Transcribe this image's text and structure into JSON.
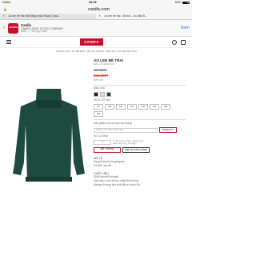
{
  "status": {
    "carrier": "Viettel",
    "time": "09:25",
    "battery": "50%"
  },
  "browser": {
    "url": "canifa.com",
    "tabs": [
      "Áo len bé trai mặt đăng nhập thoại (Cloud...",
      "Áo len bé trai - Bé trai - Ưu đãi 00..."
    ]
  },
  "banner": {
    "app_name": "Canifa",
    "company": "CANIFA JOINT STOCK COMPANY",
    "store": "Miễn — Trên App Store",
    "view": "Xem",
    "logo_text": "CANIFA"
  },
  "header": {
    "logo": "CANIFA"
  },
  "breadcrumb": "TRANG CHỦ / ÁO BÉ ĐÓN - BLACK FRIDAY / BÉ TRAI / ÁO LEN BÉ TRAI",
  "product": {
    "title": "ÁO LEN BÉ TRAI",
    "sku": "MÃ: 2TE18A001N",
    "old_price": "329.000₫",
    "new_price": "164.500₫",
    "discount": "50% Off",
    "color_label": "MÀU SẮC",
    "colors": [
      "#1e1f22",
      "#d8d8d8",
      "#1e4a40"
    ],
    "size_label": "KÍCH CỠ 160",
    "sizes": [
      "90",
      "100",
      "110",
      "120",
      "130",
      "140",
      "150",
      "160"
    ],
    "notify_label": "Sản phẩm chỉ còn bán cửa hàng",
    "email_placeholder": "Nhập email nhận thông báo",
    "notify_button": "ĐĂNG KÝ",
    "qty_label": "SỐ LƯỢNG",
    "qty": "1",
    "qty_note": "(* Giá trị sản phẩm nguyên giá, giảm giá trong 15 ngày)",
    "sold_out": "HẾT HÀNG",
    "find_store": "TÌM TẠI CỬA HÀNG",
    "details": {
      "origin_title": "MÔ TẢ",
      "origin_text": "Dáng thông thường/regular",
      "origin_text2": "Cổ kiểu, tay dài",
      "material_title": "CHẤT LIỆU",
      "material_text": "50%Cotton50%Acrylic",
      "material_text2": "Giặt máy ở chế độ êm, nhiệt độ thường",
      "material_text3": "Không sử dụng hóa chất tẩy có chứa Clo"
    }
  },
  "colors": {
    "brand": "#c8102e",
    "sale": "#e2432a",
    "sweater": "#1e4a40"
  }
}
